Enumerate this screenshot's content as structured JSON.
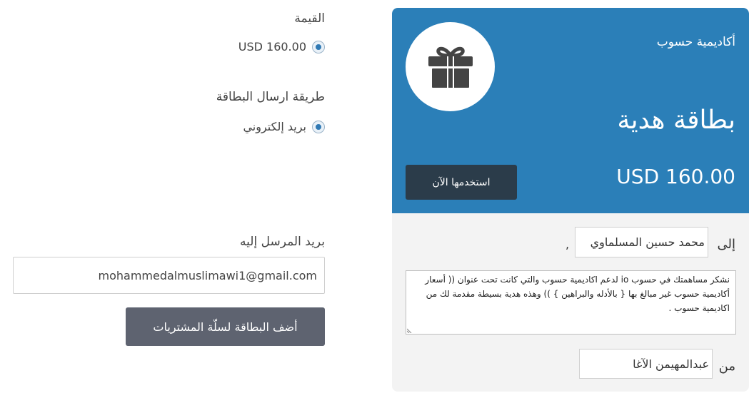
{
  "form": {
    "value_label": "القيمة",
    "value_option": "USD 160.00",
    "delivery_label": "طريقة ارسال البطاقة",
    "delivery_option": "بريد إلكتروني",
    "recipient_email_label": "بريد المرسل إليه",
    "recipient_email_value": "mohammedalmuslimawi1@gmail.com",
    "add_to_cart_label": "أضف البطاقة لسلّة المشتريات"
  },
  "card": {
    "academy": "أكاديمية حسوب",
    "title": "بطاقة هدية",
    "price": "USD 160.00",
    "use_now_label": "استخدمها الآن",
    "to_label": "إلى",
    "to_value": "محمد حسين المسلماوي",
    "to_suffix": ",",
    "message": "نشكر مساهمتك في حسوب io لدعم اكاديمية حسوب والتي كانت تحت عنوان (( أسعار أكاديمية حسوب غير مبالغ بها { بالأدله والبراهين } )) وهذه هدية بسيطة مقدمة لك من اكاديمية حسوب .",
    "from_label": "من",
    "from_value": "عبدالمهيمن الآغا"
  },
  "icons": {
    "gift": "gift-icon"
  },
  "colors": {
    "card_blue": "#2b7fb8",
    "use_button": "#2b3c4a",
    "add_button": "#5e6370",
    "radio_accent": "#2f79b4"
  }
}
